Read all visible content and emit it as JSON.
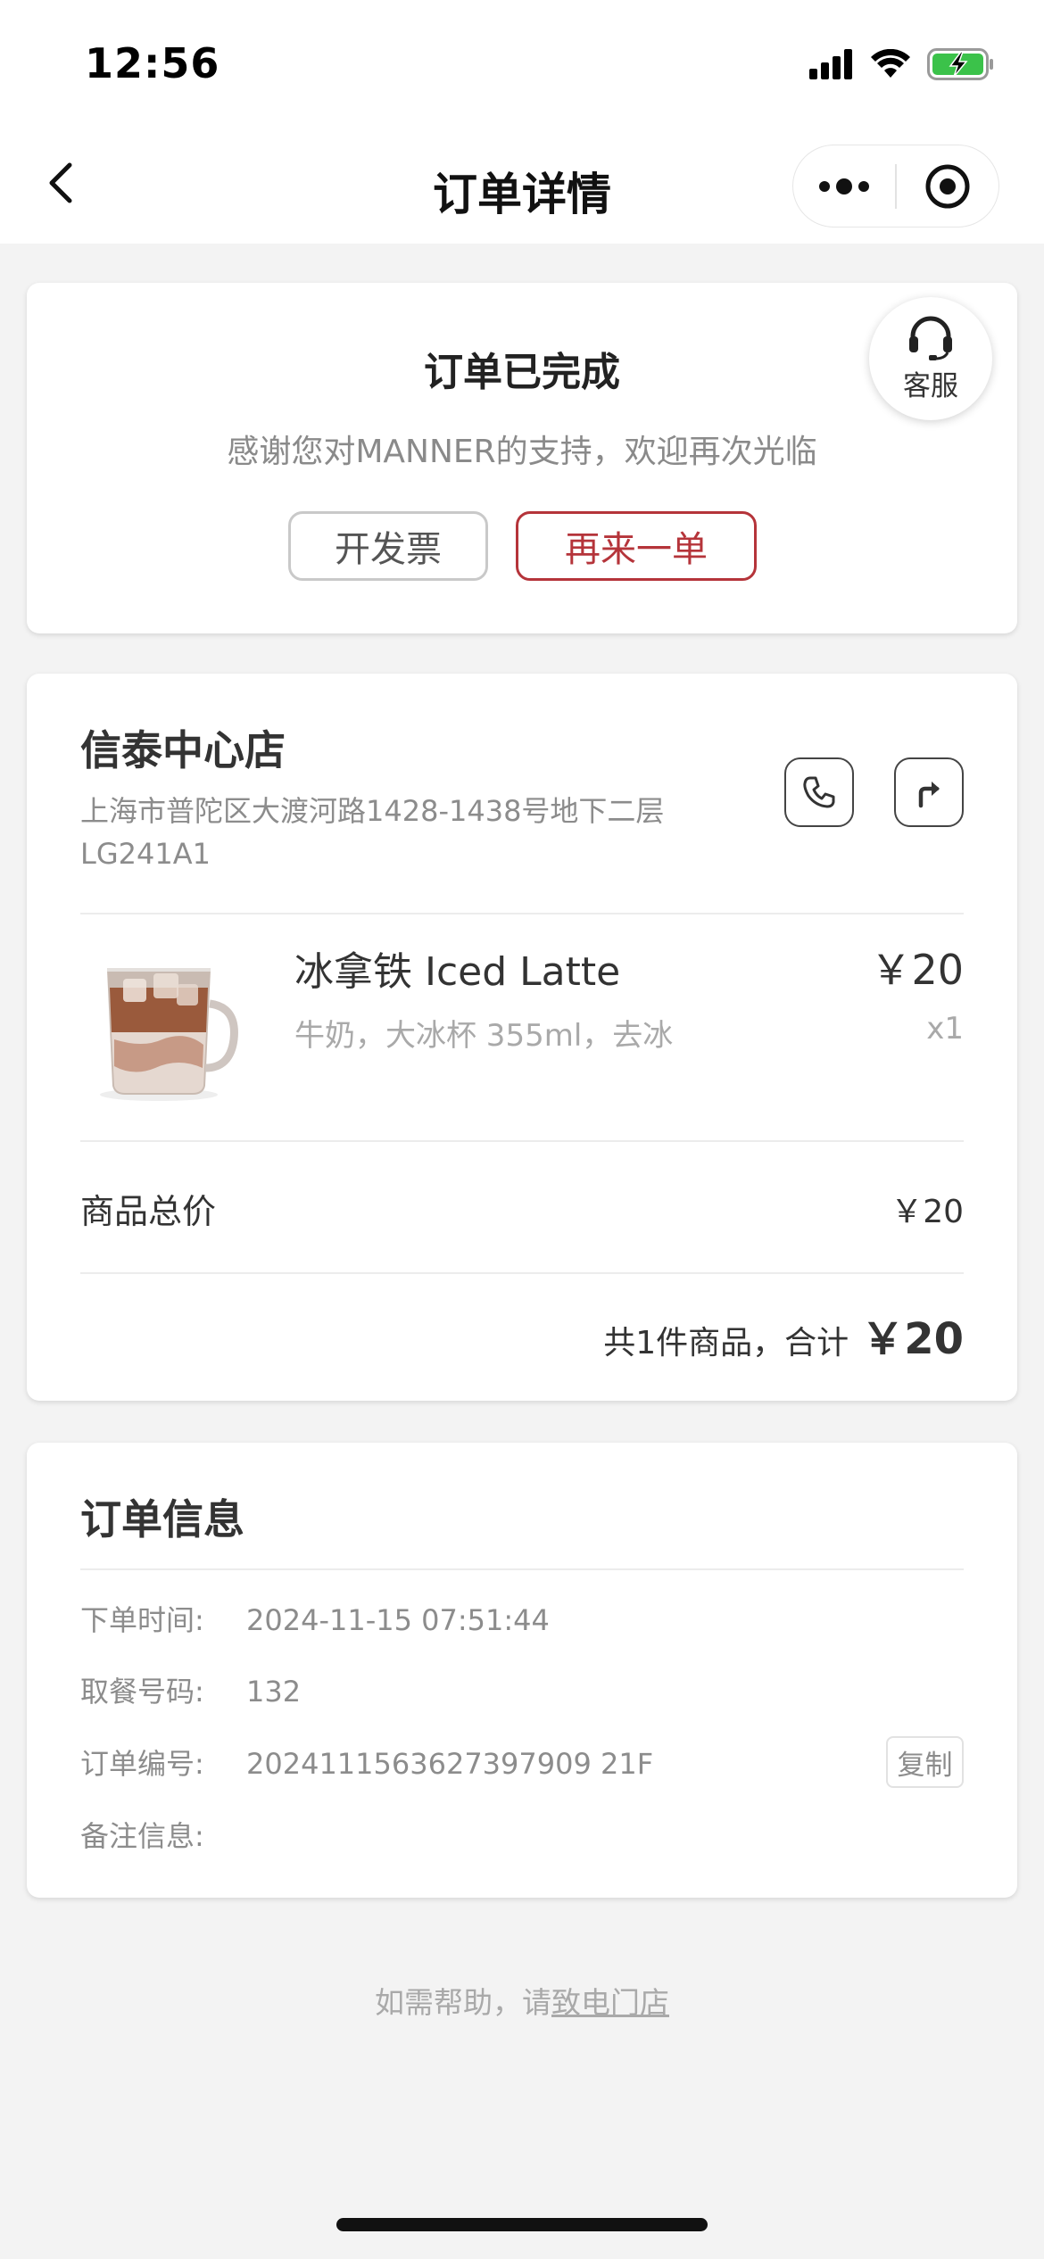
{
  "status_bar": {
    "time": "12:56",
    "icons": [
      "signal-icon",
      "wifi-icon",
      "battery-charging-icon"
    ]
  },
  "nav": {
    "title": "订单详情",
    "back_icon": "chevron-left-icon",
    "more_icon": "more-dots-icon",
    "close_icon": "target-icon"
  },
  "order_status": {
    "title": "订单已完成",
    "subtitle": "感谢您对MANNER的支持，欢迎再次光临",
    "invoice_button": "开发票",
    "reorder_button": "再来一单",
    "service_label": "客服"
  },
  "store": {
    "name": "信泰中心店",
    "address": "上海市普陀区大渡河路1428-1438号地下二层LG241A1"
  },
  "items": [
    {
      "name": "冰拿铁 Iced Latte",
      "spec": "牛奶，大冰杯 355ml，去冰",
      "price": "￥20",
      "qty": "x1"
    }
  ],
  "summary": {
    "subtotal_label": "商品总价",
    "subtotal_value": "￥20",
    "total_text": "共1件商品，合计",
    "total_value": "￥20"
  },
  "order_info": {
    "title": "订单信息",
    "rows": [
      {
        "label": "下单时间:",
        "value": "2024-11-15 07:51:44"
      },
      {
        "label": "取餐号码:",
        "value": "132"
      },
      {
        "label": "订单编号:",
        "value": "2024111563627397909 21F"
      },
      {
        "label": "备注信息:",
        "value": ""
      }
    ],
    "copy_button": "复制"
  },
  "footer": {
    "help_text": "如需帮助，请",
    "help_link": "致电门店"
  },
  "colors": {
    "accent": "#b5343a",
    "background": "#f3f3f3",
    "battery": "#3bc24a"
  }
}
